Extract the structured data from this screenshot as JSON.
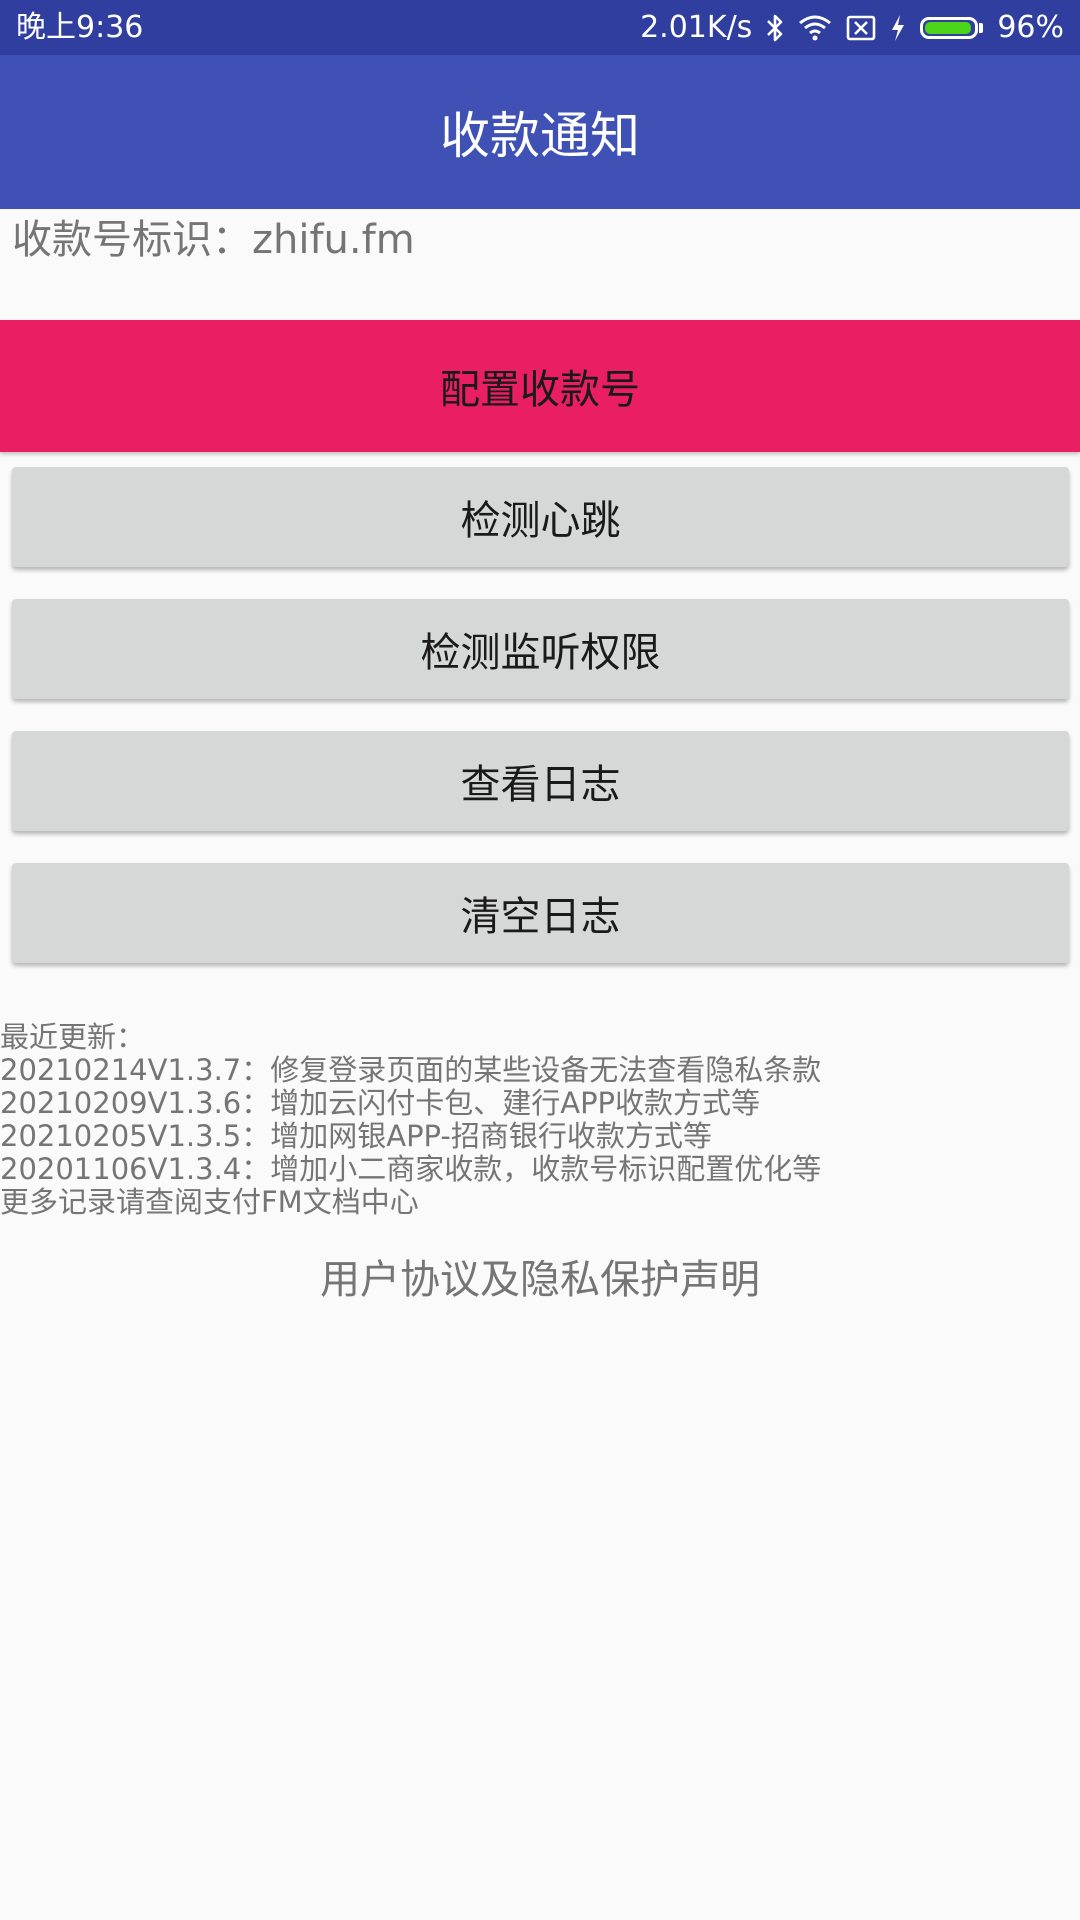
{
  "status_bar": {
    "time": "晚上9:36",
    "network_speed": "2.01K/s",
    "battery_percent": "96%",
    "battery_level": 0.96,
    "icons": [
      "bluetooth-icon",
      "wifi-icon",
      "sim-off-icon",
      "charging-icon",
      "battery-icon"
    ],
    "battery_color": "#4cd419"
  },
  "app_bar": {
    "title": "收款通知",
    "color": "#3f51b5"
  },
  "account": {
    "label": "收款号标识：zhifu.fm"
  },
  "buttons": {
    "configure": "配置收款号",
    "heartbeat": "检测心跳",
    "permission": "检测监听权限",
    "view_log": "查看日志",
    "clear_log": "清空日志"
  },
  "updates": {
    "header": "最近更新：",
    "entries": [
      "20210214V1.3.7：修复登录页面的某些设备无法查看隐私条款",
      "20210209V1.3.6：增加云闪付卡包、建行APP收款方式等",
      "20210205V1.3.5：增加网银APP-招商银行收款方式等",
      "20201106V1.3.4：增加小二商家收款，收款号标识配置优化等"
    ],
    "footer": "更多记录请查阅支付FM文档中心"
  },
  "agreement": {
    "link_text": "用户协议及隐私保护声明"
  },
  "colors": {
    "primary": "#3f51b5",
    "primary_dark": "#303f9f",
    "accent": "#e91e63",
    "button_gray": "#d6d7d7",
    "secondary_text": "#757575"
  }
}
